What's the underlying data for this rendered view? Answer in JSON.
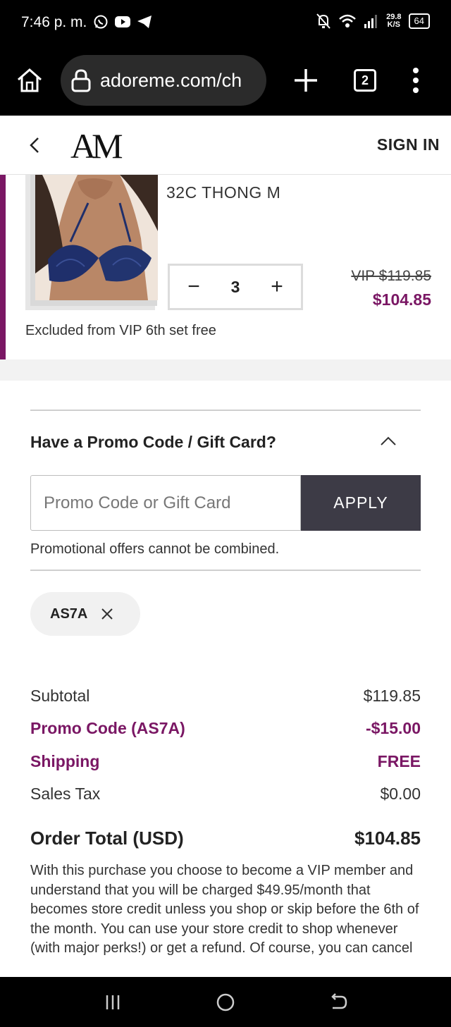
{
  "status_bar": {
    "time": "7:46 p. m.",
    "speed_value": "29.8",
    "speed_unit": "K/S",
    "battery": "64"
  },
  "browser": {
    "url": "adoreme.com/ch",
    "tab_count": "2"
  },
  "site_header": {
    "logo": "AM",
    "sign_in_label": "SIGN IN"
  },
  "product": {
    "variant": "32C  THONG M",
    "quantity": "3",
    "original_price": "VIP $119.85",
    "price": "$104.85",
    "note": "Excluded from VIP 6th set free"
  },
  "promo": {
    "heading": "Have a Promo Code / Gift Card?",
    "input_placeholder": "Promo Code or Gift Card",
    "apply_label": "APPLY",
    "note": "Promotional offers cannot be combined.",
    "applied_code": "AS7A"
  },
  "summary": {
    "subtotal_label": "Subtotal",
    "subtotal_value": "$119.85",
    "promo_label": "Promo Code (AS7A)",
    "promo_value": "-$15.00",
    "shipping_label": "Shipping",
    "shipping_value": "FREE",
    "tax_label": "Sales Tax",
    "tax_value": "$0.00",
    "total_label": "Order Total (USD)",
    "total_value": "$104.85"
  },
  "disclaimer": "With this purchase you choose to become a VIP member and understand that you will be charged $49.95/month that becomes store credit unless you shop or skip before the 6th of the month. You can use your store credit to shop whenever (with major perks!) or get a refund. Of course, you can cancel",
  "colors": {
    "accent_purple": "#7a1764",
    "apply_button": "#3d3b46"
  },
  "icons": [
    "whatsapp-icon",
    "youtube-icon",
    "telegram-icon",
    "mute-icon",
    "wifi-icon",
    "signal-icon",
    "home-icon",
    "lock-icon",
    "plus-icon",
    "more-vert-icon",
    "back-chevron-icon",
    "chevron-up-icon",
    "close-icon",
    "recents-icon",
    "nav-home-icon",
    "nav-back-icon"
  ]
}
